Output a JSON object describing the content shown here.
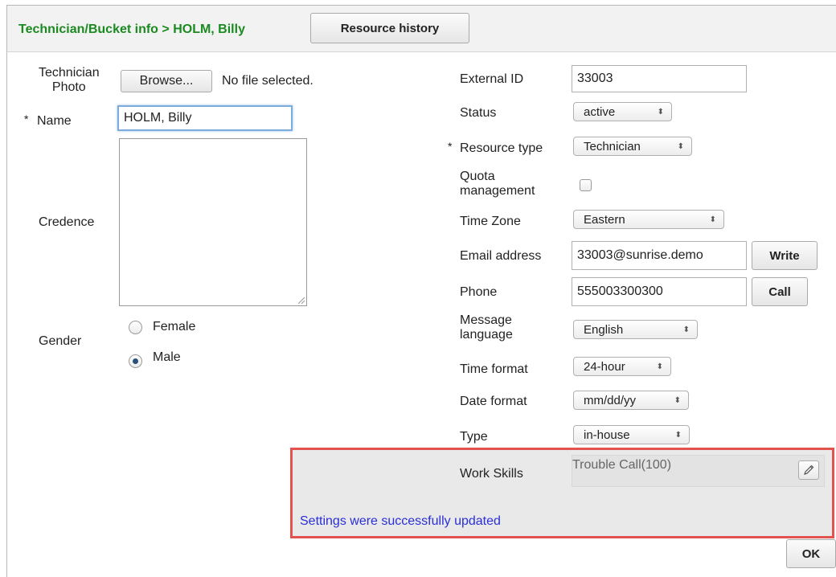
{
  "header": {
    "breadcrumb": "Technician/Bucket info > HOLM, Billy",
    "resource_history_label": "Resource history"
  },
  "form_left": {
    "photo_label_1": "Technician",
    "photo_label_2": "Photo",
    "browse_label": "Browse...",
    "no_file_text": "No file selected.",
    "required_mark": "*",
    "name_label": "Name",
    "name_value": "HOLM, Billy",
    "credence_label": "Credence",
    "gender_label": "Gender",
    "gender_options": [
      "Female",
      "Male"
    ],
    "gender_selected": "Male"
  },
  "form_right": {
    "external_id_label": "External ID",
    "external_id_value": "33003",
    "status_label": "Status",
    "status_value": "active",
    "resource_type_label": "Resource type",
    "resource_type_value": "Technician",
    "quota_label_1": "Quota",
    "quota_label_2": "management",
    "quota_checked": false,
    "time_zone_label": "Time Zone",
    "time_zone_value": "Eastern",
    "email_label": "Email address",
    "email_value": "33003@sunrise.demo",
    "write_label": "Write",
    "phone_label": "Phone",
    "phone_value": "555003300300",
    "call_label": "Call",
    "message_language_label_1": "Message",
    "message_language_label_2": "language",
    "message_language_value": "English",
    "time_format_label": "Time format",
    "time_format_value": "24-hour",
    "date_format_label": "Date format",
    "date_format_value": "mm/dd/yy",
    "type_label": "Type",
    "type_value": "in-house"
  },
  "skills": {
    "label": "Work Skills",
    "value": "Trouble Call(100)",
    "success_message": "Settings were successfully updated"
  },
  "footer": {
    "ok_label": "OK"
  },
  "colors": {
    "breadcrumb": "#1b8a21",
    "highlight_border": "#e2524f",
    "success_text": "#2a2fd6"
  },
  "icons": {
    "select_arrow": "up-down-arrows-icon",
    "edit": "pencil-icon"
  }
}
